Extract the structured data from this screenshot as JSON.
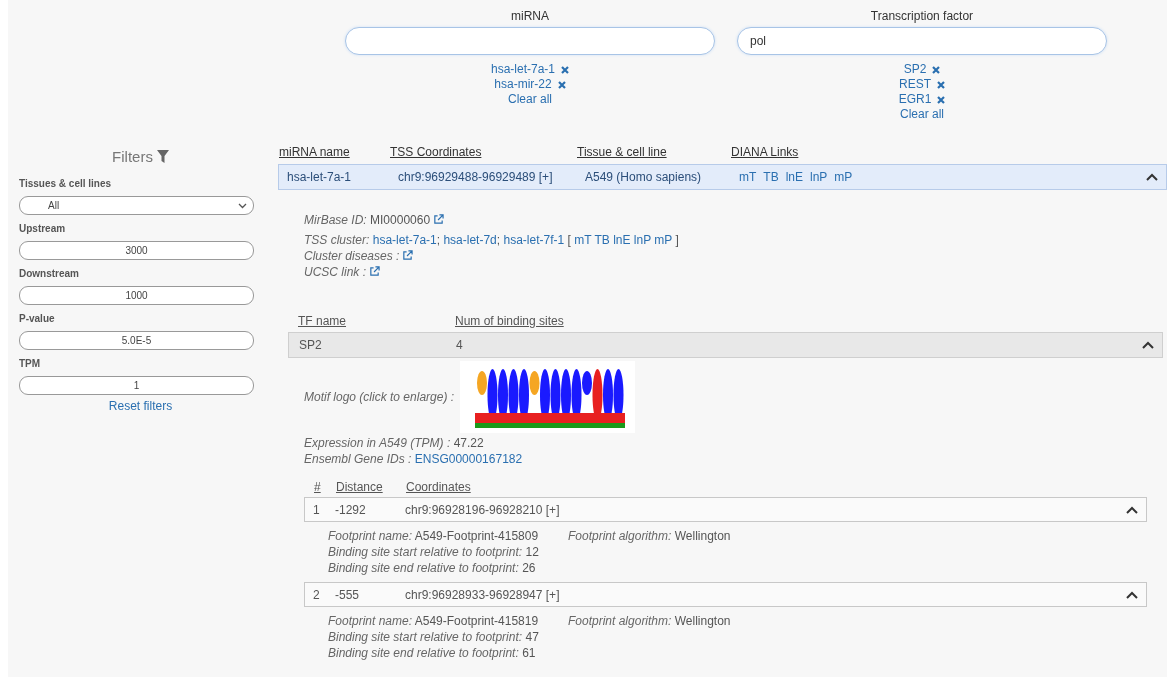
{
  "search": [
    {
      "label": "miRNA",
      "chips": [
        "hsa-let-7a-1",
        "hsa-mir-22"
      ],
      "clear": "Clear all"
    },
    {
      "label": "Transcription factor",
      "value": "pol",
      "chips": [
        "SP2",
        "REST",
        "EGR1"
      ],
      "clear": "Clear all"
    }
  ],
  "filters": {
    "title": "Filters",
    "fields": [
      {
        "label": "Tissues & cell lines",
        "kind": "select",
        "value": "All"
      },
      {
        "label": "Upstream",
        "kind": "input",
        "value": "3000"
      },
      {
        "label": "Downstream",
        "kind": "input",
        "value": "1000"
      },
      {
        "label": "P-value",
        "kind": "input",
        "value": "5.0E-5"
      },
      {
        "label": "TPM",
        "kind": "input",
        "value": "1"
      }
    ],
    "reset": "Reset filters"
  },
  "mirna_table": {
    "columns": [
      "miRNA name",
      "TSS Coordinates",
      "Tissue & cell line",
      "DIANA Links"
    ],
    "rows": [
      {
        "name": "hsa-let-7a-1",
        "tss": "chr9:96929488-96929489 [+]",
        "tissue": "A549 (Homo sapiens)",
        "links": [
          "mT",
          "TB",
          "lnE",
          "lnP",
          "mP"
        ],
        "expanded": true,
        "details": {
          "mirbase_label": "MirBase ID:",
          "mirbase_value": "MI0000060",
          "cluster_label": "TSS cluster:",
          "cluster": [
            "hsa-let-7a-1",
            "hsa-let-7d",
            "hsa-let-7f-1"
          ],
          "separator": ";",
          "open": "[",
          "cluster_links": [
            "mT",
            "TB",
            "lnE",
            "lnP",
            "mP"
          ],
          "close": "]",
          "diseases_label": "Cluster diseases :",
          "ucsc_label": "UCSC link :",
          "tf_table": {
            "columns": [
              "TF name",
              "Num of binding sites"
            ],
            "rows": [
              {
                "name": "SP2",
                "count": "4",
                "expanded": true,
                "motif_label": "Motif logo (click to enlarge) :",
                "expression_label": "Expression in A549 (TPM) :",
                "expression": "47.22",
                "ensembl_label": "Ensembl Gene IDs :",
                "ensembl": "ENSG00000167182",
                "sites": {
                  "columns": [
                    "#",
                    "Distance",
                    "Coordinates"
                  ],
                  "rows": [
                    {
                      "num": "1",
                      "distance": "-1292",
                      "coords": "chr9:96928196-96928210 [+]",
                      "expanded": true,
                      "fp_name_label": "Footprint name:",
                      "fp_name": "A549-Footprint-415809",
                      "algo_label": "Footprint algorithm:",
                      "algo": "Wellington",
                      "start_label": "Binding site start relative to footprint:",
                      "start": "12",
                      "end_label": "Binding site end relative to footprint:",
                      "end": "26"
                    },
                    {
                      "num": "2",
                      "distance": "-555",
                      "coords": "chr9:96928933-96928947 [+]",
                      "expanded": true,
                      "fp_name_label": "Footprint name:",
                      "fp_name": "A549-Footprint-415819",
                      "algo_label": "Footprint algorithm:",
                      "algo": "Wellington",
                      "start_label": "Binding site start relative to footprint:",
                      "start": "47",
                      "end_label": "Binding site end relative to footprint:",
                      "end": "61"
                    }
                  ]
                }
              }
            ]
          }
        }
      }
    ]
  }
}
